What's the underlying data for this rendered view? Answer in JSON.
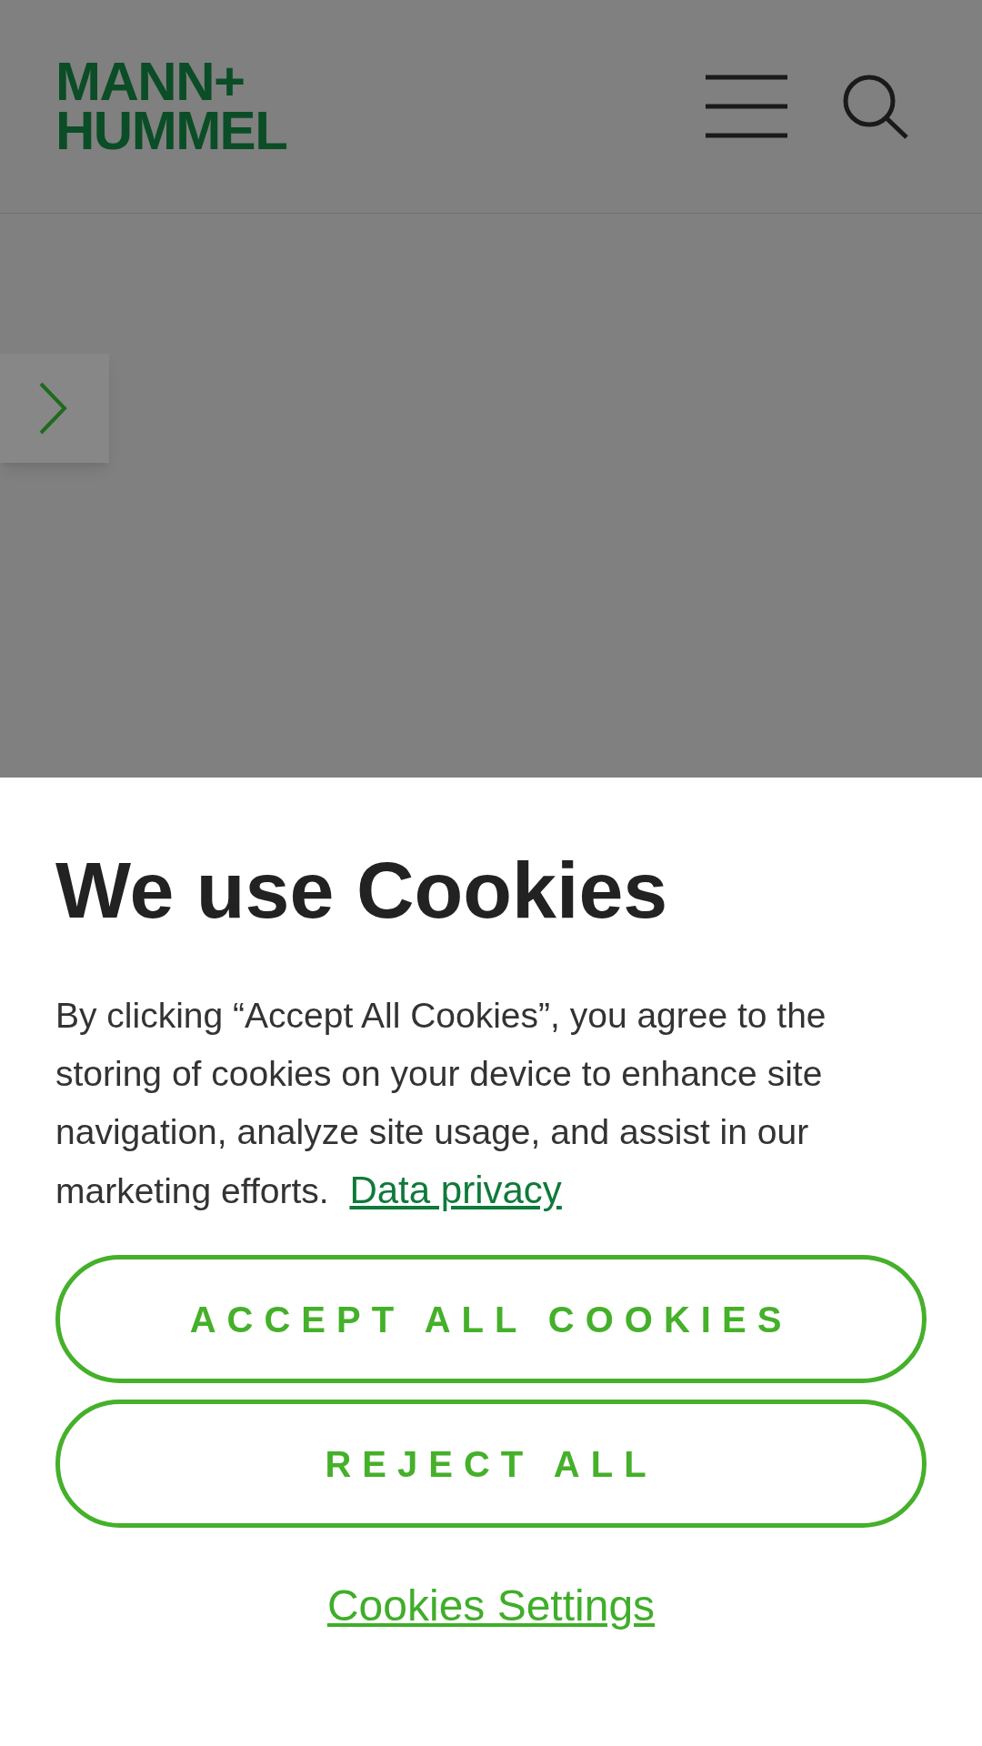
{
  "header": {
    "logo_lines": [
      "MANN+",
      "HUMMEL"
    ]
  },
  "cookie_banner": {
    "title": "We use Cookies",
    "text": "By clicking “Accept All Cookies”, you agree to the storing of cookies on your device to enhance site navigation, analyze site usage, and assist in our marketing efforts.",
    "link": "Data privacy",
    "buttons": [
      "ACCEPT ALL COOKIES",
      "REJECT ALL"
    ],
    "settings_link": "Cookies Settings"
  }
}
